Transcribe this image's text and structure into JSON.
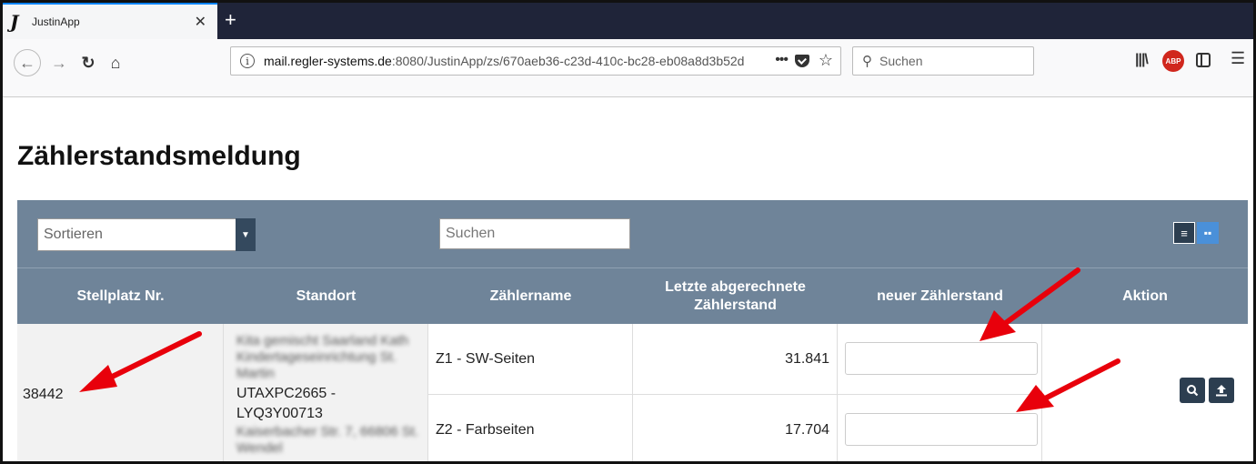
{
  "browser": {
    "tab_title": "JustinApp",
    "tab_logo": "J",
    "url_host": "mail.regler-systems.de",
    "url_rest": ":8080/JustinApp/zs/670aeb36-c23d-410c-bc28-eb08a8d3b52d",
    "search_placeholder": "Suchen",
    "url_more": "•••",
    "abp_label": "ABP"
  },
  "page": {
    "title": "Zählerstandsmeldung"
  },
  "toolbar": {
    "sort_label": "Sortieren",
    "search_placeholder": "Suchen"
  },
  "table": {
    "headers": [
      "Stellplatz Nr.",
      "Standort",
      "Zählername",
      "Letzte abgerechnete Zählerstand",
      "neuer Zählerstand",
      "Aktion"
    ],
    "row": {
      "stellplatz": "38442",
      "standort_blur_top": "Kita gemischt Saarland Kath Kindertageseinrichtung St. Martin",
      "standort_serial": "UTAXPC2665 - LYQ3Y00713",
      "standort_blur_bottom": "Kaiserbacher Str. 7, 66806 St. Wendel",
      "meters": [
        {
          "name": "Z1 - SW-Seiten",
          "value": "31.841"
        },
        {
          "name": "Z2 - Farbseiten",
          "value": "17.704"
        }
      ]
    }
  },
  "colors": {
    "accent_bar": "#6f8499",
    "dark_button": "#2c3e50",
    "grid_button": "#4a90d9",
    "arrow": "#e8000b"
  }
}
